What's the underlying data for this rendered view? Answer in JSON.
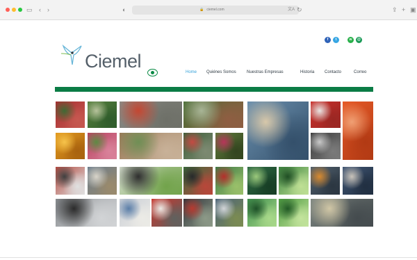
{
  "browser": {
    "address": "ciemel.com",
    "traffic_lights": [
      "#ff5f57",
      "#febc2e",
      "#28c840"
    ],
    "toolbar_icons": [
      "sidebar-icon",
      "back-icon",
      "forward-icon",
      "privacy-icon",
      "translate-icon",
      "refresh-icon",
      "share-icon",
      "new-tab-icon",
      "tabs-icon"
    ]
  },
  "site": {
    "logo": "Ciemel",
    "social": [
      {
        "icon": "facebook-icon",
        "label": "f",
        "color": "#2f63b8"
      },
      {
        "icon": "twitter-icon",
        "label": "t",
        "color": "#36a6e3"
      },
      {
        "icon": "whatsapp-icon",
        "label": "w",
        "color": "#29b04a"
      },
      {
        "icon": "email-icon",
        "label": "@",
        "color": "#1a9a57"
      }
    ],
    "nav": [
      "Home",
      "Quiénes Somos",
      "Nuestras Empresas",
      "Historia",
      "Contacto",
      "Correo"
    ],
    "active_nav": "Home",
    "brand_green": "#0b7c45"
  },
  "gallery": [
    {
      "name": "red-flowers-greenhouse-photo",
      "colors": [
        "#a72f31",
        "#3f6a34",
        "#c65850"
      ]
    },
    {
      "name": "green-seedling-rows-photo",
      "colors": [
        "#557f3c",
        "#b6c29b",
        "#2f5c2b"
      ]
    },
    {
      "name": "truck-yard-photo",
      "colors": [
        "#8b8c87",
        "#c44732",
        "#6e7068"
      ]
    },
    {
      "name": "greenhouse-road-photo",
      "colors": [
        "#4a6d36",
        "#a8b596",
        "#8f5e42"
      ]
    },
    {
      "name": "dragonfly-closeup-photo",
      "colors": [
        "#6a8fad",
        "#d8c8aa",
        "#34506b"
      ]
    },
    {
      "name": "red-pipe-spool-photo",
      "colors": [
        "#c9302b",
        "#e8e5e3",
        "#9a2723"
      ]
    },
    {
      "name": "orange-coil-photo",
      "colors": [
        "#e65a27",
        "#f0a074",
        "#b23a14"
      ]
    },
    {
      "name": "honeycomb-bee-photo",
      "colors": [
        "#e39a1e",
        "#f6c34b",
        "#a8620f"
      ]
    },
    {
      "name": "pink-flower-field-photo",
      "colors": [
        "#b7415f",
        "#5e8a43",
        "#d9829a"
      ]
    },
    {
      "name": "gravel-quarry-photo",
      "colors": [
        "#9a7a58",
        "#6f8f55",
        "#c8b198"
      ]
    },
    {
      "name": "workers-greenhouse-photo",
      "colors": [
        "#3e5f3a",
        "#c44a43",
        "#7d8a72"
      ]
    },
    {
      "name": "pink-blossoms-photo",
      "colors": [
        "#5f7a3c",
        "#b63559",
        "#33451f"
      ]
    },
    {
      "name": "black-pipes-photo",
      "colors": [
        "#3b3b3b",
        "#c9c9c9",
        "#7a7a7a"
      ]
    },
    {
      "name": "packing-workers-photo",
      "colors": [
        "#b34b41",
        "#404040",
        "#e0e0e0"
      ]
    },
    {
      "name": "greenhouse-building-photo",
      "colors": [
        "#6b7c8b",
        "#d8d4c9",
        "#9a8a6c"
      ]
    },
    {
      "name": "man-with-plants-photo",
      "colors": [
        "#d7dfd0",
        "#2e2e2e",
        "#72a34b"
      ]
    },
    {
      "name": "green-hoses-photo",
      "colors": [
        "#3c6b3d",
        "#27292b",
        "#b8473a"
      ]
    },
    {
      "name": "greenhouse-interior-photo",
      "colors": [
        "#3f7a47",
        "#b52f2b",
        "#9ac06a"
      ]
    },
    {
      "name": "fern-fronds-photo",
      "colors": [
        "#2e6a43",
        "#9bc97c",
        "#173e25"
      ]
    },
    {
      "name": "palm-leaves-photo",
      "colors": [
        "#3f8640",
        "#1f4e24",
        "#bfe095"
      ]
    },
    {
      "name": "factory-workers-photo",
      "colors": [
        "#51606d",
        "#d88a2f",
        "#2b3641"
      ]
    },
    {
      "name": "factory-line-photo",
      "colors": [
        "#3f5573",
        "#c9c3ba",
        "#212f41"
      ]
    },
    {
      "name": "hands-closeup-photo",
      "colors": [
        "#8b8f93",
        "#2b2b2b",
        "#d2d4d6"
      ]
    },
    {
      "name": "packages-photo",
      "colors": [
        "#c9ced6",
        "#5b7ea8",
        "#ecebe6"
      ]
    },
    {
      "name": "red-sign-photo",
      "colors": [
        "#c8352d",
        "#eceae5",
        "#60615e"
      ]
    },
    {
      "name": "hose-reels-photo",
      "colors": [
        "#30343a",
        "#b83a30",
        "#8d9a88"
      ]
    },
    {
      "name": "shelving-photo",
      "colors": [
        "#4b6378",
        "#d2d5d8",
        "#7b8b52"
      ]
    },
    {
      "name": "fern-closeup-photo",
      "colors": [
        "#3e8f4c",
        "#1e5128",
        "#a9d98a"
      ]
    },
    {
      "name": "fern-leaf-photo",
      "colors": [
        "#4c9a3f",
        "#225a26",
        "#c4e49d"
      ]
    },
    {
      "name": "pallets-warehouse-photo",
      "colors": [
        "#7c8580",
        "#d1c7a6",
        "#444b4e"
      ]
    }
  ]
}
